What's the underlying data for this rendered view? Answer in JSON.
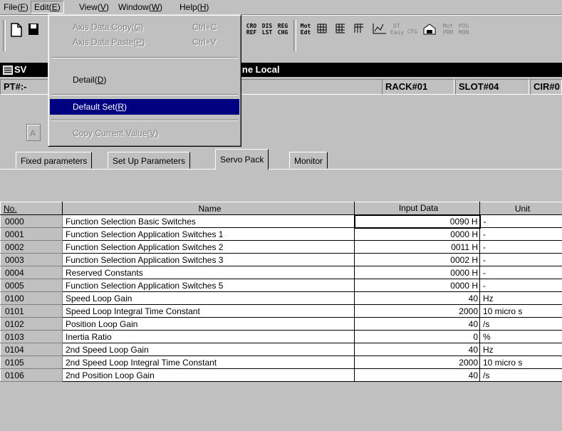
{
  "menubar": {
    "file": {
      "pre": "File(",
      "key": "F",
      "post": ")"
    },
    "edit": {
      "pre": "Edit(",
      "key": "E",
      "post": ")"
    },
    "view": {
      "pre": "View(",
      "key": "V",
      "post": ")"
    },
    "window": {
      "pre": "Window(",
      "key": "W",
      "post": ")"
    },
    "help": {
      "pre": "Help(",
      "key": "H",
      "post": ")"
    }
  },
  "toolbar": {
    "icons": [
      {
        "l1": "CRO",
        "l2": "REF"
      },
      {
        "l1": "DIS",
        "l2": "LST"
      },
      {
        "l1": "REG",
        "l2": "CHG"
      },
      {
        "l1": "Mot",
        "l2": "Edt"
      },
      {
        "l1": "DT",
        "l2": "Easy"
      },
      {
        "l1": "CFG",
        "l2": ""
      },
      {
        "l1": "Mot",
        "l2": "PRM"
      },
      {
        "l1": "POS",
        "l2": "MON"
      }
    ]
  },
  "edit_menu": {
    "items": [
      {
        "pre": "Axis Data Copy(",
        "key": "C",
        "post": ")",
        "shortcut": "Ctrl+C"
      },
      {
        "pre": "Axis Data Paste(",
        "key": "P",
        "post": ")",
        "shortcut": "Ctrl+V"
      },
      {
        "pre": "Detail(",
        "key": "D",
        "post": ")"
      },
      {
        "pre": "Default Set(",
        "key": "R",
        "post": ")"
      },
      {
        "pre": "Copy Current Value(",
        "key": "V",
        "post": ")"
      }
    ]
  },
  "window": {
    "title_left": "SV",
    "title_right": "ffline  Local",
    "pt_label": "PT#:-",
    "rack": "RACK#01",
    "slot": "SLOT#04",
    "cir": "CIR#0",
    "ghost_button": "A"
  },
  "tabs": [
    "Fixed parameters",
    "Set Up Parameters",
    "Servo Pack",
    "Monitor"
  ],
  "table": {
    "headers": {
      "no": "No.",
      "name": "Name",
      "input": "Input Data",
      "unit": "Unit"
    },
    "rows": [
      {
        "no": "0000",
        "name": "Function Selection Basic Switches",
        "input": "0090 H",
        "unit": "-"
      },
      {
        "no": "0001",
        "name": "Function Selection Application Switches 1",
        "input": "0000 H",
        "unit": "-"
      },
      {
        "no": "0002",
        "name": "Function Selection Application Switches 2",
        "input": "0011 H",
        "unit": "-"
      },
      {
        "no": "0003",
        "name": "Function Selection Application Switches 3",
        "input": "0002 H",
        "unit": "-"
      },
      {
        "no": "0004",
        "name": "Reserved Constants",
        "input": "0000 H",
        "unit": "-"
      },
      {
        "no": "0005",
        "name": "Function Selection Application Switches 5",
        "input": "0000 H",
        "unit": "-"
      },
      {
        "no": "0100",
        "name": "Speed Loop Gain",
        "input": "40",
        "unit": "Hz"
      },
      {
        "no": "0101",
        "name": "Speed Loop Integral Time Constant",
        "input": "2000",
        "unit": "10 micro s"
      },
      {
        "no": "0102",
        "name": "Position Loop Gain",
        "input": "40",
        "unit": "/s"
      },
      {
        "no": "0103",
        "name": "Inertia Ratio",
        "input": "0",
        "unit": "%"
      },
      {
        "no": "0104",
        "name": "2nd Speed Loop Gain",
        "input": "40",
        "unit": "Hz"
      },
      {
        "no": "0105",
        "name": "2nd Speed Loop Integral Time Constant",
        "input": "2000",
        "unit": "10 micro s"
      },
      {
        "no": "0106",
        "name": "2nd Position Loop Gain",
        "input": "40",
        "unit": "/s"
      }
    ]
  }
}
